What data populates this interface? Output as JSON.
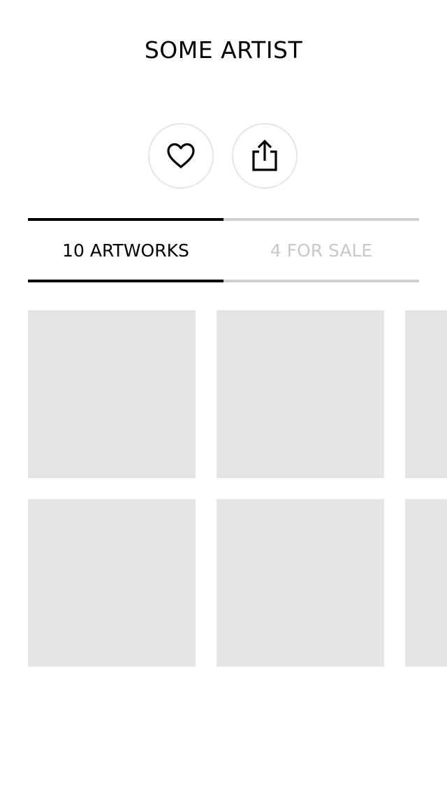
{
  "artist": {
    "name": "SOME ARTIST"
  },
  "actions": {
    "favorite_icon": "heart-outline-icon",
    "share_icon": "share-icon"
  },
  "tabs": [
    {
      "label": "10 ARTWORKS",
      "active": true
    },
    {
      "label": "4 FOR SALE",
      "active": false
    }
  ],
  "colors": {
    "placeholder": "#e5e5e5",
    "active_tab": "#000000",
    "inactive_tab": "#c8c8c8",
    "button_border": "#e5e5e5"
  }
}
